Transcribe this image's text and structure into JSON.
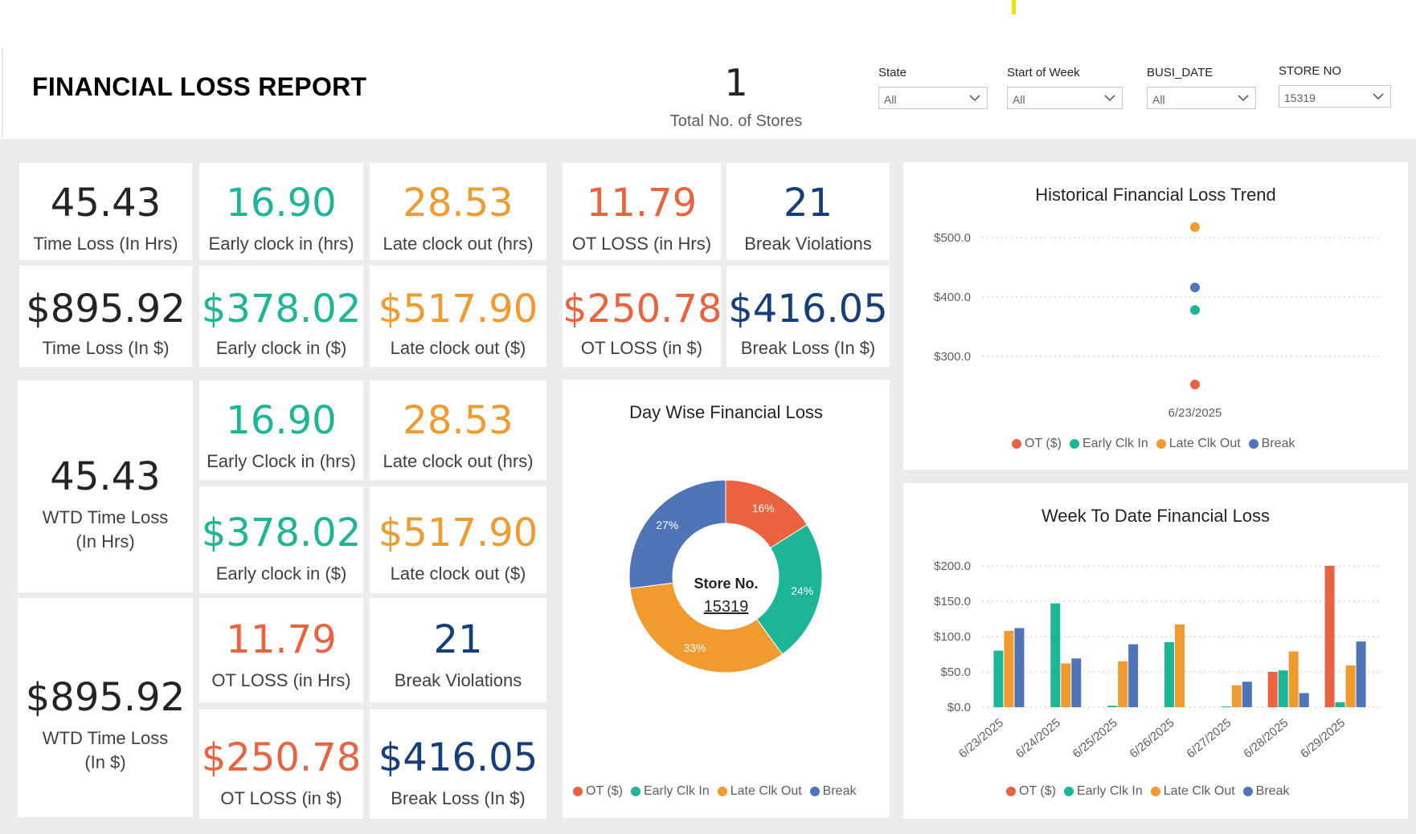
{
  "header": {
    "title": "FINANCIAL LOSS REPORT",
    "store_count_value": "1",
    "store_count_label": "Total No. of Stores"
  },
  "filters": [
    {
      "label": "State",
      "value": "All"
    },
    {
      "label": "Start of Week",
      "value": "All"
    },
    {
      "label": "BUSI_DATE",
      "value": "All"
    },
    {
      "label": "STORE NO",
      "value": "15319"
    }
  ],
  "kpis_top": {
    "time_loss_hrs": {
      "value": "45.43",
      "label": "Time Loss (In Hrs)"
    },
    "early_clock_in_hrs": {
      "value": "16.90",
      "label": "Early clock in (hrs)"
    },
    "late_clock_out_hrs": {
      "value": "28.53",
      "label": "Late clock out (hrs)"
    },
    "ot_loss_hrs": {
      "value": "11.79",
      "label": "OT LOSS (in Hrs)"
    },
    "break_violations": {
      "value": "21",
      "label": "Break Violations"
    },
    "time_loss_usd": {
      "value": "$895.92",
      "label": "Time Loss (In $)"
    },
    "early_clock_in_usd": {
      "value": "$378.02",
      "label": "Early clock in ($)"
    },
    "late_clock_out_usd": {
      "value": "$517.90",
      "label": "Late clock out ($)"
    },
    "ot_loss_usd": {
      "value": "$250.78",
      "label": "OT LOSS (in $)"
    },
    "break_loss_usd": {
      "value": "$416.05",
      "label": "Break Loss (In $)"
    }
  },
  "kpis_wtd": {
    "wtd_time_loss_hrs": {
      "value": "45.43",
      "label_line1": "WTD Time Loss",
      "label_line2": "(In Hrs)"
    },
    "early_clock_in_hrs": {
      "value": "16.90",
      "label": "Early Clock in (hrs)"
    },
    "late_clock_out_hrs": {
      "value": "28.53",
      "label": "Late clock out (hrs)"
    },
    "early_clock_in_usd": {
      "value": "$378.02",
      "label": "Early clock in ($)"
    },
    "late_clock_out_usd": {
      "value": "$517.90",
      "label": "Late clock out ($)"
    },
    "wtd_time_loss_usd": {
      "value": "$895.92",
      "label_line1": "WTD Time Loss",
      "label_line2": "(In $)"
    },
    "ot_loss_hrs": {
      "value": "11.79",
      "label": "OT LOSS (in Hrs)"
    },
    "break_violations": {
      "value": "21",
      "label": "Break Violations"
    },
    "ot_loss_usd": {
      "value": "$250.78",
      "label": "OT LOSS (in $)"
    },
    "break_loss_usd": {
      "value": "$416.05",
      "label": "Break Loss (In $)"
    }
  },
  "colors": {
    "ot": "#ea6340",
    "early": "#1cb596",
    "late": "#ef9b2f",
    "break": "#4f74b8"
  },
  "legend_labels": [
    "OT ($)",
    "Early Clk In",
    "Late Clk Out",
    "Break"
  ],
  "chart_data": [
    {
      "type": "pie",
      "title": "Day Wise Financial Loss",
      "center_label": "Store No.",
      "center_value": "15319",
      "categories": [
        "OT ($)",
        "Early Clk In",
        "Late Clk Out",
        "Break"
      ],
      "values": [
        16,
        24,
        33,
        27
      ],
      "data_labels": [
        "16%",
        "24%",
        "33%",
        "27%"
      ]
    },
    {
      "type": "scatter",
      "title": "Historical Financial Loss Trend",
      "x": [
        "6/23/2025"
      ],
      "series": [
        {
          "name": "OT ($)",
          "values": [
            250.78
          ]
        },
        {
          "name": "Early Clk In",
          "values": [
            378.02
          ]
        },
        {
          "name": "Late Clk Out",
          "values": [
            517.9
          ]
        },
        {
          "name": "Break",
          "values": [
            416.05
          ]
        }
      ],
      "y_ticks": [
        "$500.0",
        "$400.0",
        "$300.0"
      ],
      "ylim": [
        255,
        530
      ],
      "grid": true,
      "legend": "bottom"
    },
    {
      "type": "bar",
      "title": "Week To Date Financial Loss",
      "categories": [
        "6/23/2025",
        "6/24/2025",
        "6/25/2025",
        "6/26/2025",
        "6/27/2025",
        "6/28/2025",
        "6/29/2025"
      ],
      "series": [
        {
          "name": "OT ($)",
          "values": [
            0,
            0,
            0,
            0,
            0,
            50,
            200
          ]
        },
        {
          "name": "Early Clk In",
          "values": [
            80,
            147,
            2,
            92,
            1,
            52,
            7
          ]
        },
        {
          "name": "Late Clk Out",
          "values": [
            108,
            62,
            65,
            117,
            31,
            79,
            59
          ]
        },
        {
          "name": "Break",
          "values": [
            112,
            69,
            89,
            0,
            36,
            20,
            93
          ]
        }
      ],
      "y_ticks": [
        "$200.0",
        "$150.0",
        "$100.0",
        "$50.0",
        "$0.0"
      ],
      "ylim": [
        0,
        200
      ],
      "grid": true,
      "legend": "bottom"
    }
  ]
}
